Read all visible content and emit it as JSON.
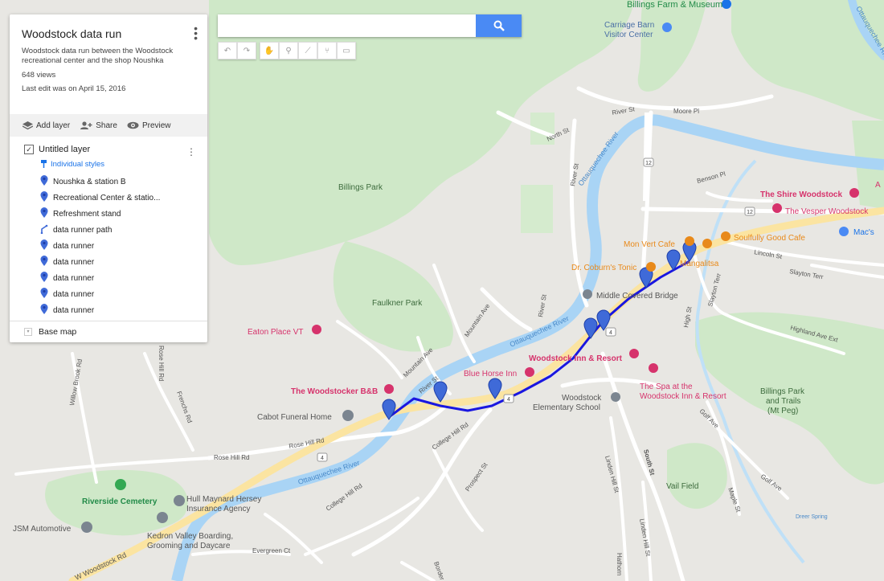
{
  "map_info": {
    "title": "Woodstock data run",
    "description": "Woodstock data run between the Woodstock recreational center and the shop Noushka",
    "views": "648 views",
    "last_edit": "Last edit was on April 15, 2016"
  },
  "actions": {
    "add_layer": "Add layer",
    "share": "Share",
    "preview": "Preview"
  },
  "layer": {
    "name": "Untitled layer",
    "styles_label": "Individual styles",
    "items": [
      {
        "label": "Noushka & station B",
        "icon": "marker-icon"
      },
      {
        "label": "Recreational Center & statio...",
        "icon": "marker-icon"
      },
      {
        "label": "Refreshment stand",
        "icon": "marker-icon"
      },
      {
        "label": "data runner path",
        "icon": "line-path-icon"
      },
      {
        "label": "data runner",
        "icon": "marker-icon"
      },
      {
        "label": "data runner",
        "icon": "marker-icon"
      },
      {
        "label": "data runner",
        "icon": "marker-icon"
      },
      {
        "label": "data runner",
        "icon": "marker-icon"
      },
      {
        "label": "data runner",
        "icon": "marker-icon"
      }
    ]
  },
  "base_map": "Base map",
  "search": {
    "placeholder": ""
  },
  "colors": {
    "route": "#1a17e0",
    "marker": "#3f6ad8",
    "river": "#a9d4f5",
    "park": "#cfe8c8",
    "highway": "#fbe4a1",
    "poi_pink": "#d6336c",
    "poi_orange": "#e8891a"
  },
  "map_labels": {
    "billings_farm": "Billings Farm & Museum",
    "carriage_barn": "Carriage Barn",
    "visitor_center": "Visitor Center",
    "river_st_n": "River St",
    "moore_pl": "Moore Pl",
    "north_st": "North St",
    "river_ottau_n": "Ottauquechee River",
    "river_ottau_ne": "Ottauquechee River",
    "rt12_n": "12",
    "billings_park": "Billings Park",
    "river_st_mid": "River St",
    "benson_pl": "Benson Pl",
    "shire": "The Shire Woodstock",
    "vesper": "The Vesper Woodstock",
    "a_label": "A",
    "rt12_e": "12",
    "macs": "Mac's",
    "mon_vert": "Mon Vert Cafe",
    "soulfully": "Soulfully Good Cafe",
    "dr_coburn": "Dr. Coburn's Tonic",
    "mangalitsa": "Mangalitsa",
    "lincoln_st": "Lincoln St",
    "slayton_terr": "Slayton Terr",
    "slayton_terr2": "Slayton Terr",
    "middle_bridge": "Middle Covered Bridge",
    "faulkner": "Faulkner Park",
    "river_st_low": "River St",
    "mountain_ave": "Mountain Ave",
    "mountain_ave2": "Mountain Ave",
    "high_st": "High St",
    "highland_ave": "Highland Ave Ext",
    "eaton": "Eaton Place VT",
    "ottau_river_mid": "Ottauquechee River",
    "woodstock_inn": "Woodstock Inn & Resort",
    "spa_1": "The Spa at the",
    "spa_2": "Woodstock Inn & Resort",
    "blue_horse": "Blue Horse Inn",
    "woodstocker": "The Woodstocker B&B",
    "river_st_sw": "River St",
    "cabot": "Cabot Funeral Home",
    "woodstock_elem_1": "Woodstock",
    "woodstock_elem_2": "Elementary School",
    "billings_trails_1": "Billings Park",
    "billings_trails_2": "and Trails",
    "billings_trails_3": "(Mt Peg)",
    "willow_brook": "Willow Brook Rd",
    "frenchs": "Frenchs Rd",
    "rose_hill_1": "Rose Hill Rd",
    "rose_hill_2": "Rose Hill Rd",
    "rose_hill_3": "Rose Hill Rd",
    "college_hill_1": "College Hill Rd",
    "college_hill_2": "College Hill Rd",
    "prospect": "Prospect St",
    "golf_ave_1": "Golf Ave",
    "golf_ave_2": "Golf Ave",
    "south_st": "South St",
    "linden_1": "Linden Hill St",
    "linden_2": "Linden Hill St",
    "vail_field": "Vail Field",
    "maple_st": "Maple St",
    "dreer_spring": "Dreer Spring",
    "ottau_river_sw": "Ottauquechee River",
    "riverside": "Riverside Cemetery",
    "hull_1": "Hull Maynard Hersey",
    "hull_2": "Insurance Agency",
    "jsm": "JSM Automotive",
    "kedron_1": "Kedron Valley Boarding,",
    "kedron_2": "Grooming and Daycare",
    "evergreen": "Evergreen Ct",
    "w_woodstock": "W Woodstock Rd",
    "border": "Border",
    "hathorn": "Hathorn",
    "rt4_a": "4",
    "rt4_b": "4",
    "rt4_c": "4"
  }
}
